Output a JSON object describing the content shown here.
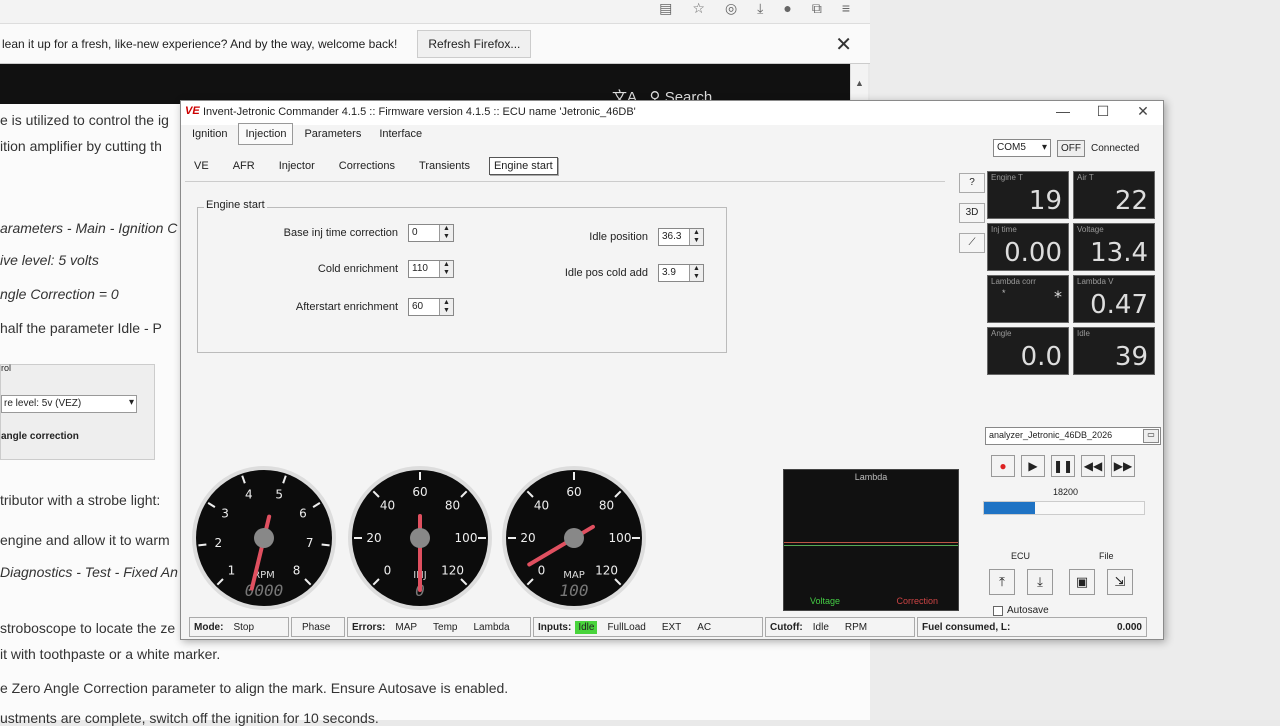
{
  "browser": {
    "notification": "lean it up for a fresh, like-new experience? And by the way, welcome back!",
    "refresh_label": "Refresh Firefox...",
    "close_glyph": "✕",
    "search_label": "Search",
    "page_lines": [
      "e is utilized to control the ig",
      "ition amplifier by cutting th",
      "arameters - Main - Ignition C",
      "ive level: 5 volts",
      "ngle Correction = 0",
      " half the parameter Idle - P",
      "tributor with a strobe light:",
      "engine and allow it to warm",
      "Diagnostics - Test - Fixed An",
      "stroboscope to locate the ze"
    ],
    "panel_title": "rol",
    "panel_select": "re level: 5v (VEZ)",
    "panel_label": "angle correction",
    "bottom_lines": [
      "it with toothpaste or a white marker.",
      "e Zero Angle Correction parameter to align the mark. Ensure Autosave is enabled.",
      "ustments are complete, switch off the ignition for 10 seconds."
    ]
  },
  "window": {
    "logo": "VE",
    "title": "Invent-Jetronic Commander 4.1.5 :: Firmware version 4.1.5 :: ECU name 'Jetronic_46DB'",
    "tabs": [
      "Ignition",
      "Injection",
      "Parameters",
      "Interface"
    ],
    "active_tab": "Injection",
    "subtabs": [
      "VE",
      "AFR",
      "Injector",
      "Corrections",
      "Transients",
      "Engine start"
    ],
    "active_subtab": "Engine start",
    "group_title": "Engine start",
    "fields_left": [
      {
        "label": "Base inj time correction",
        "value": "0"
      },
      {
        "label": "Cold enrichment",
        "value": "110"
      },
      {
        "label": "Afterstart enrichment",
        "value": "60"
      }
    ],
    "fields_right": [
      {
        "label": "Idle position",
        "value": "36.3"
      },
      {
        "label": "Idle pos cold add",
        "value": "3.9"
      }
    ]
  },
  "gauges": {
    "rpm": {
      "label": "RPM",
      "digital": "0000",
      "ticks": [
        "1",
        "2",
        "3",
        "4",
        "5",
        "6",
        "7",
        "8"
      ],
      "value_fraction": 0.55
    },
    "inj": {
      "label": "INJ",
      "digital": "0",
      "ticks": [
        "0",
        "20",
        "40",
        "60",
        "80",
        "100",
        "120"
      ],
      "value_fraction": 0.5
    },
    "map": {
      "label": "MAP",
      "digital": "100",
      "ticks": [
        "0",
        "20",
        "40",
        "60",
        "80",
        "100",
        "120"
      ],
      "value_fraction": 0.72
    }
  },
  "lambda_chart": {
    "title": "Lambda",
    "left_label": "Voltage",
    "right_label": "Correction"
  },
  "statusbar": {
    "mode_label": "Mode:",
    "mode_value": "Stop",
    "phase": "Phase",
    "errors_label": "Errors:",
    "errors": [
      "MAP",
      "Temp",
      "Lambda"
    ],
    "inputs_label": "Inputs:",
    "inputs": [
      "Idle",
      "FullLoad",
      "EXT",
      "AC"
    ],
    "cutoff_label": "Cutoff:",
    "cutoff": [
      "Idle",
      "RPM"
    ],
    "fuel_label": "Fuel consumed, L:",
    "fuel_value": "0.000"
  },
  "right_panel": {
    "port": "COM5",
    "off_label": "OFF",
    "connected": "Connected",
    "help": "?",
    "three_d": "3D",
    "tiles": [
      {
        "name": "Engine T",
        "value": "19"
      },
      {
        "name": "Air T",
        "value": "22"
      },
      {
        "name": "Inj time",
        "value": "0.00"
      },
      {
        "name": "Voltage",
        "value": "13.4"
      },
      {
        "name": "Lambda corr",
        "value": "*"
      },
      {
        "name": "Lambda V",
        "value": "0.47"
      },
      {
        "name": "Angle",
        "value": "0.0"
      },
      {
        "name": "Idle",
        "value": "39"
      }
    ],
    "file_name": "analyzer_Jetronic_46DB_2026",
    "counter": "18200",
    "progress": 0.32,
    "ecu_label": "ECU",
    "file_label": "File",
    "autosave": "Autosave"
  }
}
